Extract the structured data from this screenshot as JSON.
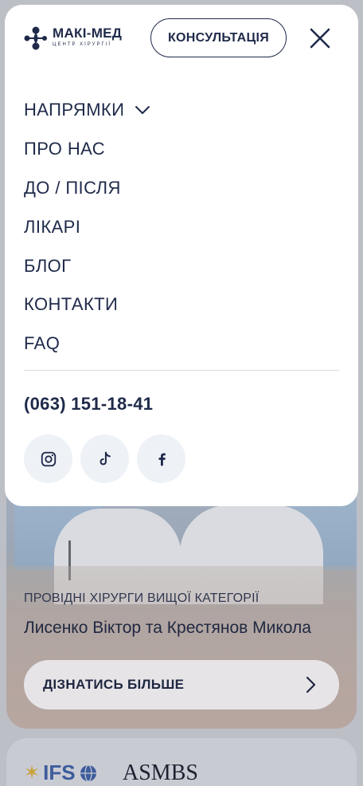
{
  "header": {
    "logo_name": "МАКІ-МЕД",
    "logo_subtitle": "ЦЕНТР ХІРУРГІЇ",
    "consult_label": "КОНСУЛЬТАЦІЯ",
    "close_icon": "close-icon"
  },
  "menu": {
    "items": [
      {
        "label": "НАПРЯМКИ",
        "has_dropdown": true
      },
      {
        "label": "ПРО НАС"
      },
      {
        "label": "ДО / ПІСЛЯ"
      },
      {
        "label": "ЛІКАРІ"
      },
      {
        "label": "БЛОГ"
      },
      {
        "label": "КОНТАКТИ"
      },
      {
        "label": "FAQ"
      }
    ],
    "phone": "(063) 151-18-41",
    "socials": [
      "instagram-icon",
      "tiktok-icon",
      "facebook-icon"
    ]
  },
  "hero": {
    "eyebrow": "ПРОВІДНІ ХІРУРГИ ВИЩОЇ КАТЕГОРІЇ",
    "title": "Лисенко Віктор та Крестянов Микола",
    "cta_label": "ДІЗНАТИСЬ БІЛЬШЕ"
  },
  "partners": {
    "ifso": "IFS",
    "asmbs": "ASMBS"
  },
  "colors": {
    "brand_navy": "#1f2a4a",
    "social_bg": "#eef1f6",
    "overlay": "#bdbfc7"
  }
}
